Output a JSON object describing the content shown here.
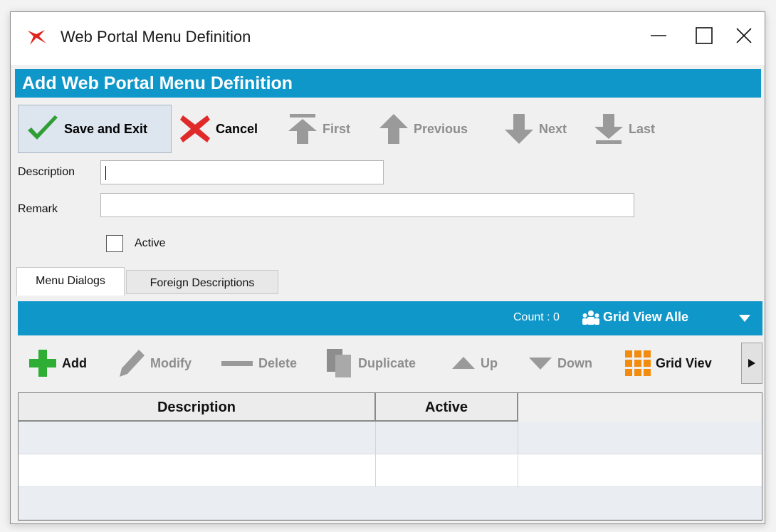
{
  "window": {
    "title": "Web Portal Menu Definition",
    "icon": "app-logo-icon",
    "controls": [
      "minimize-icon",
      "maximize-icon",
      "close-icon"
    ]
  },
  "header": {
    "title": "Add Web Portal Menu Definition",
    "color": "#1097c9"
  },
  "toolbar": {
    "save_exit": "Save and Exit",
    "cancel": "Cancel",
    "first": "First",
    "previous": "Previous",
    "next": "Next",
    "last": "Last"
  },
  "form": {
    "description_label": "Description",
    "description_value": "",
    "remark_label": "Remark",
    "remark_value": "",
    "active_label": "Active",
    "active_checked": false
  },
  "tabs": [
    {
      "label": "Menu Dialogs",
      "active": true
    },
    {
      "label": "Foreign Descriptions",
      "active": false
    }
  ],
  "panel": {
    "count_text": "Count : 0",
    "grid_view_label": "Grid View Alle"
  },
  "subtoolbar": {
    "add": "Add",
    "modify": "Modify",
    "delete": "Delete",
    "duplicate": "Duplicate",
    "up": "Up",
    "down": "Down",
    "grid_view": "Grid Viev"
  },
  "grid": {
    "columns": [
      "Description",
      "Active"
    ],
    "rows": []
  },
  "colors": {
    "accent": "#1097c9",
    "save_check": "#2e9e35",
    "cancel_x": "#e02a2a",
    "add_plus": "#2eae34",
    "grid_icon": "#f28c0f"
  }
}
